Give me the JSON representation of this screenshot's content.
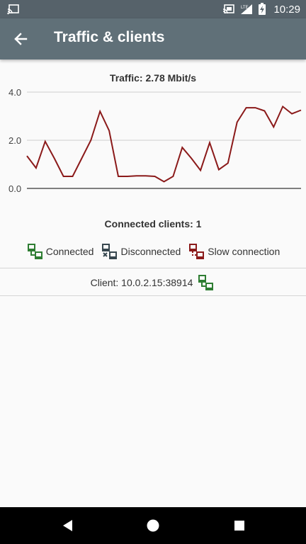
{
  "status_bar": {
    "time": "10:29",
    "network": "LTE"
  },
  "app_bar": {
    "title": "Traffic & clients"
  },
  "traffic": {
    "title": "Traffic: 2.78 Mbit/s",
    "chart_data": {
      "type": "line",
      "ylim": [
        0,
        4.0
      ],
      "yticks": [
        "0.0",
        "2.0",
        "4.0"
      ],
      "grid": true,
      "series": [
        {
          "color": "#8b1a1a",
          "values": [
            1.35,
            0.85,
            1.95,
            1.25,
            0.5,
            0.5,
            1.25,
            2.0,
            3.2,
            2.4,
            0.5,
            0.5,
            0.52,
            0.52,
            0.5,
            0.28,
            0.5,
            1.7,
            1.25,
            0.75,
            1.9,
            0.78,
            1.05,
            2.75,
            3.35,
            3.35,
            3.22,
            2.55,
            3.4,
            3.1,
            3.25
          ]
        }
      ]
    }
  },
  "clients": {
    "title": "Connected clients: 1",
    "legend": [
      {
        "label": "Connected",
        "color": "#2e7d32"
      },
      {
        "label": "Disconnected",
        "color": "#37474f"
      },
      {
        "label": "Slow connection",
        "color": "#8b1a1a"
      }
    ],
    "list": [
      {
        "label": "Client: 10.0.2.15:38914",
        "status": "connected"
      }
    ]
  }
}
